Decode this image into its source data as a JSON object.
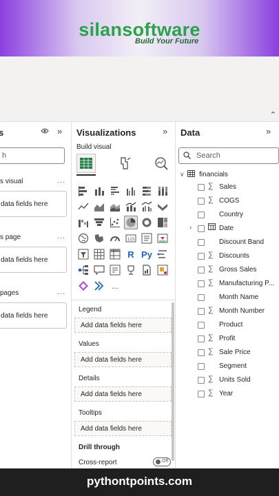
{
  "banner": {
    "brand": "silansoftware",
    "tagline": "Build Your Future"
  },
  "filters": {
    "title": "s",
    "search_placeholder": "h",
    "sections": [
      {
        "label": "s visual",
        "drop_text": "data fields here"
      },
      {
        "label": "s page",
        "drop_text": "data fields here"
      },
      {
        "label": "pages",
        "drop_text": "data fields here"
      }
    ],
    "more": "..."
  },
  "visualizations": {
    "title": "Visualizations",
    "build_visual": "Build visual",
    "more_visuals": "...",
    "wells": [
      {
        "label": "Legend",
        "placeholder": "Add data fields here"
      },
      {
        "label": "Values",
        "placeholder": "Add data fields here"
      },
      {
        "label": "Details",
        "placeholder": "Add data fields here"
      },
      {
        "label": "Tooltips",
        "placeholder": "Add data fields here"
      }
    ],
    "drill_through": "Drill through",
    "cross_report": "Cross-report",
    "toggle_state": "Off",
    "r_label": "R",
    "py_label": "Py"
  },
  "data": {
    "title": "Data",
    "search_placeholder": "Search",
    "table": "financials",
    "fields": [
      {
        "name": "Sales",
        "sigma": true
      },
      {
        "name": "COGS",
        "sigma": true
      },
      {
        "name": "Country",
        "sigma": false
      },
      {
        "name": "Date",
        "sigma": false,
        "date": true
      },
      {
        "name": "Discount Band",
        "sigma": false
      },
      {
        "name": "Discounts",
        "sigma": true
      },
      {
        "name": "Gross Sales",
        "sigma": true
      },
      {
        "name": "Manufacturing P...",
        "sigma": true
      },
      {
        "name": "Month Name",
        "sigma": false
      },
      {
        "name": "Month Number",
        "sigma": true
      },
      {
        "name": "Product",
        "sigma": false
      },
      {
        "name": "Profit",
        "sigma": true
      },
      {
        "name": "Sale Price",
        "sigma": true
      },
      {
        "name": "Segment",
        "sigma": false
      },
      {
        "name": "Units Sold",
        "sigma": true
      },
      {
        "name": "Year",
        "sigma": true
      }
    ]
  },
  "footer": {
    "site": "pythontpoints.com"
  },
  "colors": {
    "accent": "#2aa24a",
    "banner_purple": "#8b3fe0",
    "footer_bg": "#1f1f1f"
  }
}
